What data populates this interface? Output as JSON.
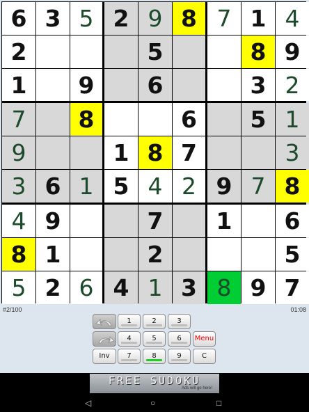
{
  "colors": {
    "highlight": "#ffff00",
    "selected": "#00cc33",
    "shaded": "#d8d8d8",
    "white": "#ffffff"
  },
  "board": {
    "digits": [
      [
        "6",
        "3",
        "5",
        "2",
        "9",
        "8",
        "7",
        "1",
        "4"
      ],
      [
        "2",
        "",
        "",
        "",
        "5",
        "",
        "",
        "8",
        "9"
      ],
      [
        "1",
        "",
        "9",
        "",
        "6",
        "",
        "",
        "3",
        "2"
      ],
      [
        "7",
        "",
        "8",
        "",
        "",
        "6",
        "",
        "5",
        "1"
      ],
      [
        "9",
        "",
        "",
        "1",
        "8",
        "7",
        "",
        "",
        "3"
      ],
      [
        "3",
        "6",
        "1",
        "5",
        "4",
        "2",
        "9",
        "7",
        "8"
      ],
      [
        "4",
        "9",
        "",
        "",
        "7",
        "",
        "1",
        "",
        "6"
      ],
      [
        "8",
        "1",
        "",
        "",
        "2",
        "",
        "",
        "",
        "5"
      ],
      [
        "5",
        "2",
        "6",
        "4",
        "1",
        "3",
        "8",
        "9",
        "7"
      ]
    ],
    "given": [
      [
        1,
        1,
        0,
        1,
        0,
        1,
        0,
        1,
        0
      ],
      [
        1,
        0,
        0,
        0,
        1,
        0,
        0,
        1,
        1
      ],
      [
        1,
        0,
        1,
        0,
        1,
        0,
        0,
        1,
        0
      ],
      [
        0,
        0,
        1,
        0,
        0,
        1,
        0,
        1,
        0
      ],
      [
        0,
        0,
        0,
        1,
        1,
        1,
        0,
        0,
        0
      ],
      [
        0,
        1,
        0,
        1,
        0,
        0,
        1,
        0,
        1
      ],
      [
        0,
        1,
        0,
        0,
        1,
        0,
        1,
        0,
        1
      ],
      [
        1,
        1,
        0,
        0,
        1,
        0,
        0,
        0,
        1
      ],
      [
        0,
        1,
        0,
        1,
        0,
        1,
        0,
        1,
        1
      ]
    ],
    "highlighted": [
      [
        0,
        5
      ],
      [
        1,
        7
      ],
      [
        3,
        2
      ],
      [
        4,
        4
      ],
      [
        5,
        8
      ],
      [
        7,
        0
      ]
    ],
    "selected": [
      8,
      6
    ]
  },
  "status": {
    "puzzle": "#2/100",
    "time": "01:08"
  },
  "keypad": {
    "digits": [
      "1",
      "2",
      "3",
      "4",
      "5",
      "6",
      "7",
      "8",
      "9"
    ],
    "active_digit": "8",
    "inv_label": "Inv",
    "menu_label": "Menu",
    "clear_label": "C"
  },
  "ad": {
    "title": "FREE SUDOKU",
    "subtitle": "Ads will go here!"
  },
  "nav": {
    "back": "◁",
    "home": "○",
    "recents": "□"
  }
}
